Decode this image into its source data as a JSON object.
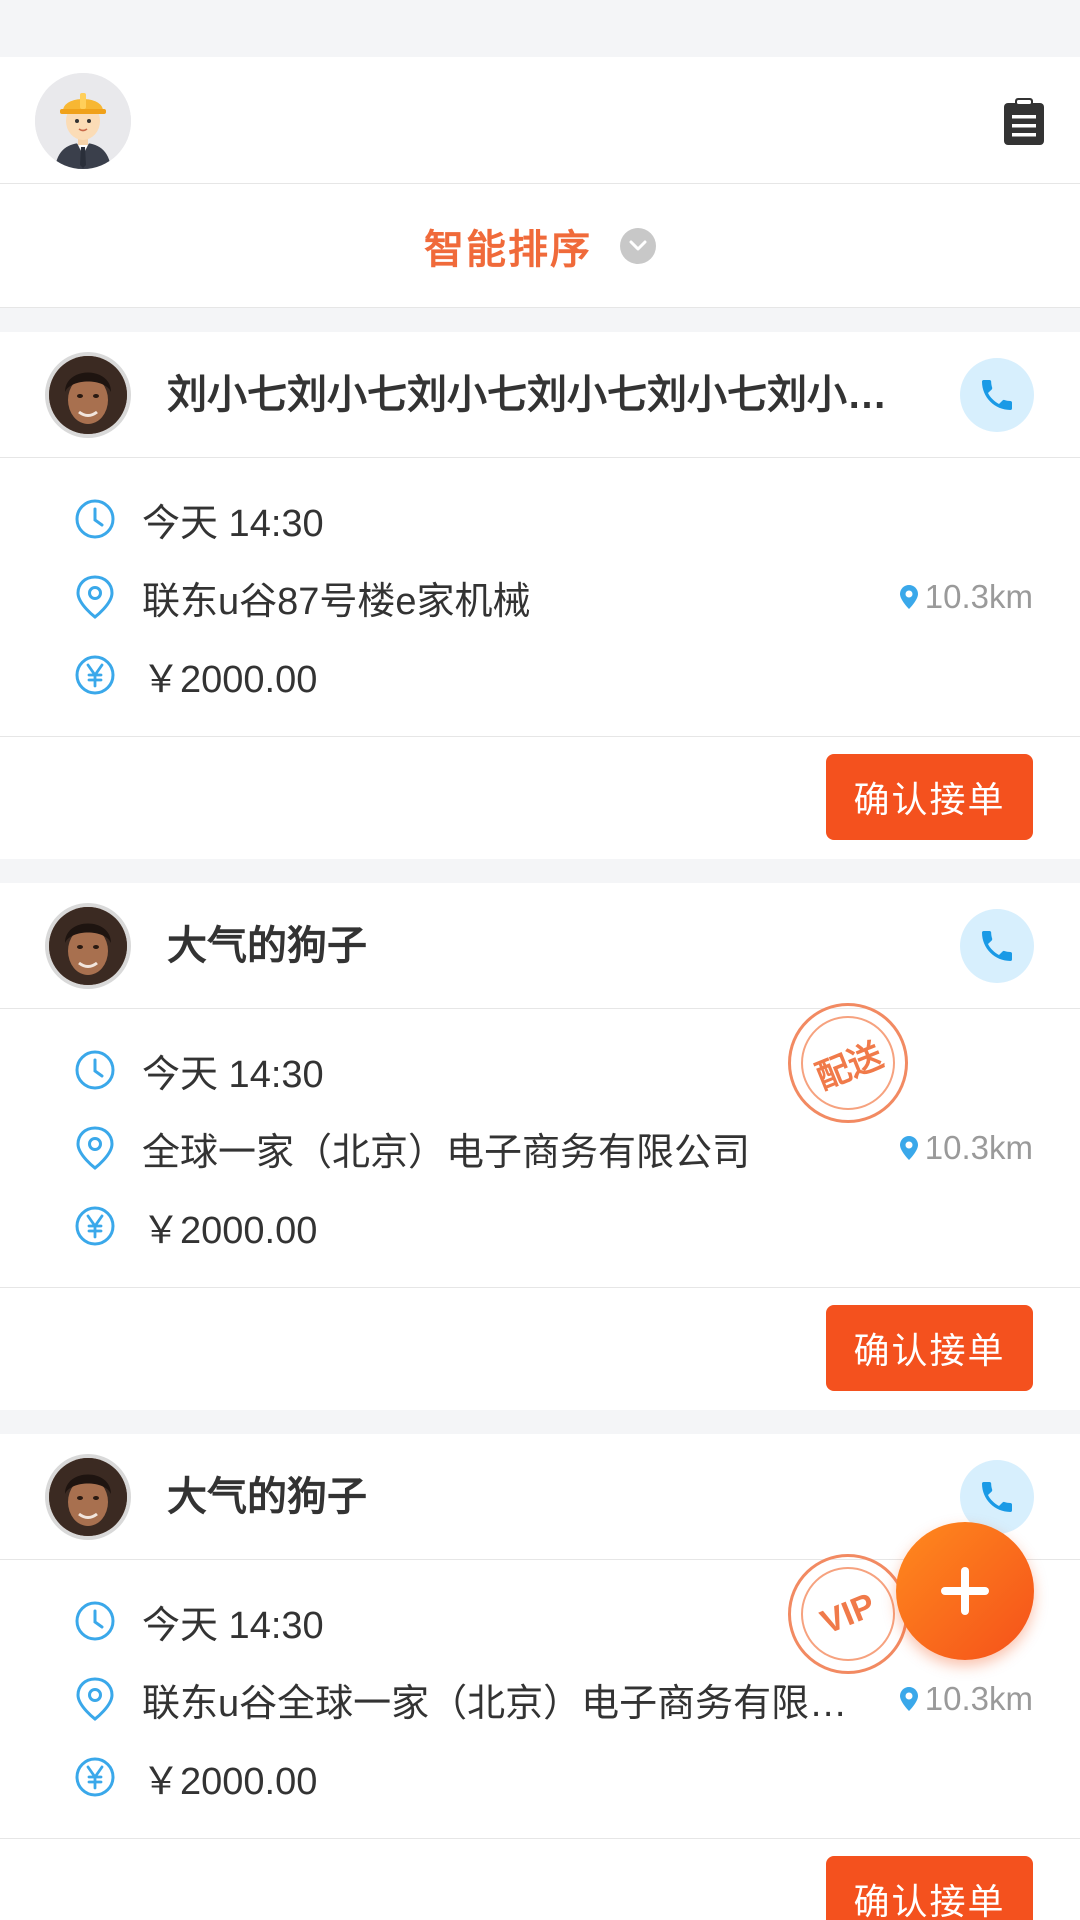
{
  "header": {
    "avatar_icon": "worker-avatar-icon",
    "clipboard_icon": "clipboard-icon"
  },
  "sort": {
    "label": "智能排序",
    "chevron_icon": "chevron-down-icon"
  },
  "orders": [
    {
      "name": "刘小七刘小七刘小七刘小七刘小七刘小七刘小七刘小七",
      "time": "今天 14:30",
      "address": "联东u谷87号楼e家机械",
      "distance": "10.3km",
      "price": "￥2000.00",
      "confirm_label": "确认接单",
      "badge": ""
    },
    {
      "name": "大气的狗子",
      "time": "今天 14:30",
      "address": "全球一家（北京）电子商务有限公司",
      "distance": "10.3km",
      "price": "￥2000.00",
      "confirm_label": "确认接单",
      "badge": "配送"
    },
    {
      "name": "大气的狗子",
      "time": "今天 14:30",
      "address": "联东u谷全球一家（北京）电子商务有限公司",
      "distance": "10.3km",
      "price": "￥2000.00",
      "confirm_label": "确认接单",
      "badge": "VIP"
    }
  ],
  "fab": {
    "icon": "plus-icon"
  },
  "colors": {
    "accent": "#f4511e",
    "sort_text": "#f06a3a",
    "icon_blue": "#3aa8ea",
    "phone_bg": "#d7effd"
  }
}
